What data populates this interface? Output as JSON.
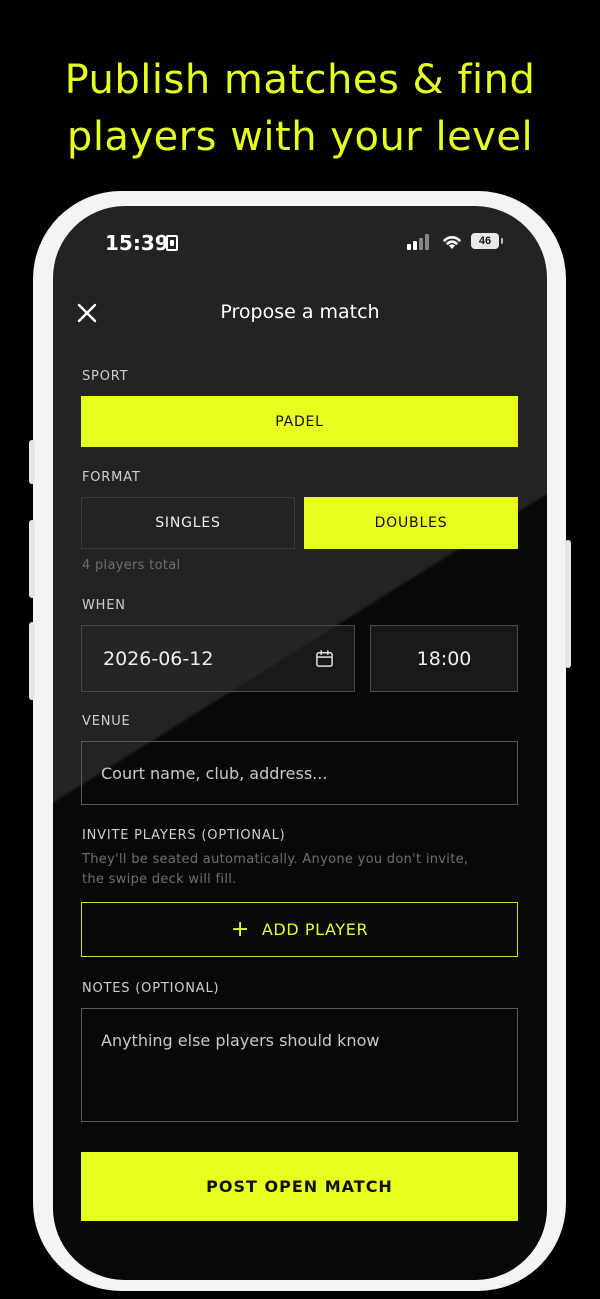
{
  "headline": {
    "line1": "Publish matches & find",
    "line2": "players with your level"
  },
  "status_bar": {
    "time": "15:39",
    "battery": "46"
  },
  "header": {
    "title": "Propose a match"
  },
  "sport": {
    "label": "SPORT",
    "selected": "PADEL"
  },
  "format": {
    "label": "FORMAT",
    "options": [
      "SINGLES",
      "DOUBLES"
    ],
    "selected": "DOUBLES",
    "helper": "4 players total"
  },
  "when": {
    "label": "WHEN",
    "date": "2026-06-12",
    "time": "18:00"
  },
  "venue": {
    "label": "VENUE",
    "placeholder": "Court name, club, address..."
  },
  "invite": {
    "label": "INVITE PLAYERS (OPTIONAL)",
    "helper_line1": "They'll be seated automatically. Anyone you don't invite,",
    "helper_line2": "the swipe deck will fill.",
    "add_label": "ADD PLAYER"
  },
  "notes": {
    "label": "NOTES (OPTIONAL)",
    "placeholder": "Anything else players should know"
  },
  "submit": {
    "label": "POST OPEN MATCH"
  },
  "colors": {
    "accent": "#e6ff1e",
    "background": "#121212"
  }
}
